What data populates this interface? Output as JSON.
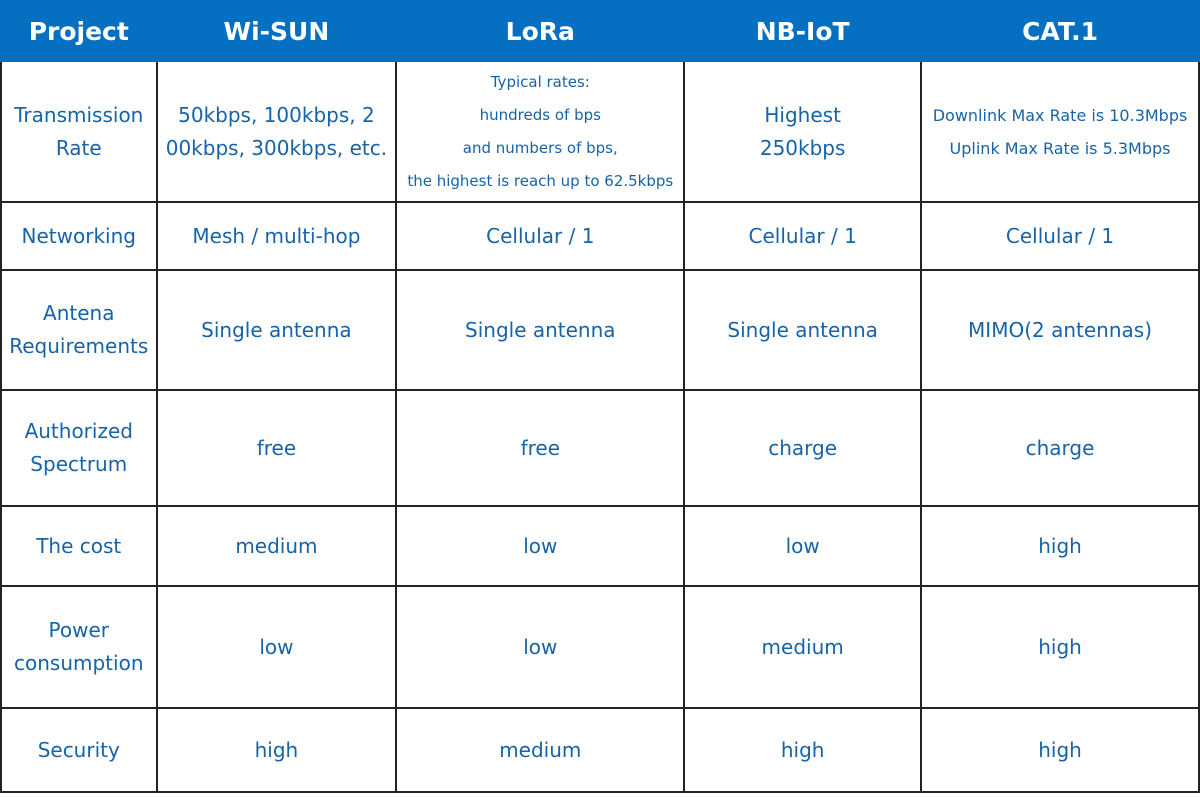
{
  "header": {
    "columns": [
      "Project",
      "Wi-SUN",
      "LoRa",
      "NB-IoT",
      "CAT.1"
    ]
  },
  "rows": [
    {
      "label": [
        "Transmission",
        "Rate"
      ],
      "wisun": [
        "50kbps, 100kbps, 2",
        "00kbps, 300kbps, etc."
      ],
      "lora": [
        "Typical rates:",
        "hundreds of bps",
        "and numbers of bps,",
        "the highest is reach up to 62.5kbps"
      ],
      "nbiot": [
        "Highest",
        "250kbps"
      ],
      "cat1": [
        "Downlink Max Rate is 10.3Mbps",
        "Uplink Max Rate is 5.3Mbps"
      ]
    },
    {
      "label": [
        "Networking"
      ],
      "wisun": [
        "Mesh /  multi-hop"
      ],
      "lora": [
        "Cellular / 1"
      ],
      "nbiot": [
        "Cellular / 1"
      ],
      "cat1": [
        "Cellular / 1"
      ]
    },
    {
      "label": [
        "Antena",
        "Requirements"
      ],
      "wisun": [
        "Single antenna"
      ],
      "lora": [
        "Single antenna"
      ],
      "nbiot": [
        "Single antenna"
      ],
      "cat1": [
        "MIMO(2 antennas)"
      ]
    },
    {
      "label": [
        "Authorized",
        "Spectrum"
      ],
      "wisun": [
        "free"
      ],
      "lora": [
        "free"
      ],
      "nbiot": [
        "charge"
      ],
      "cat1": [
        "charge"
      ]
    },
    {
      "label": [
        "The cost"
      ],
      "wisun": [
        "medium"
      ],
      "lora": [
        "low"
      ],
      "nbiot": [
        "low"
      ],
      "cat1": [
        "high"
      ]
    },
    {
      "label": [
        "Power",
        "consumption"
      ],
      "wisun": [
        "low"
      ],
      "lora": [
        "low"
      ],
      "nbiot": [
        "medium"
      ],
      "cat1": [
        "high"
      ]
    },
    {
      "label": [
        "Security"
      ],
      "wisun": [
        "high"
      ],
      "lora": [
        "medium"
      ],
      "nbiot": [
        "high"
      ],
      "cat1": [
        "high"
      ]
    }
  ],
  "colors": {
    "header_bg": "#0570c2",
    "header_text": "#ffffff",
    "cell_text": "#1763a8",
    "border": "#222222"
  }
}
